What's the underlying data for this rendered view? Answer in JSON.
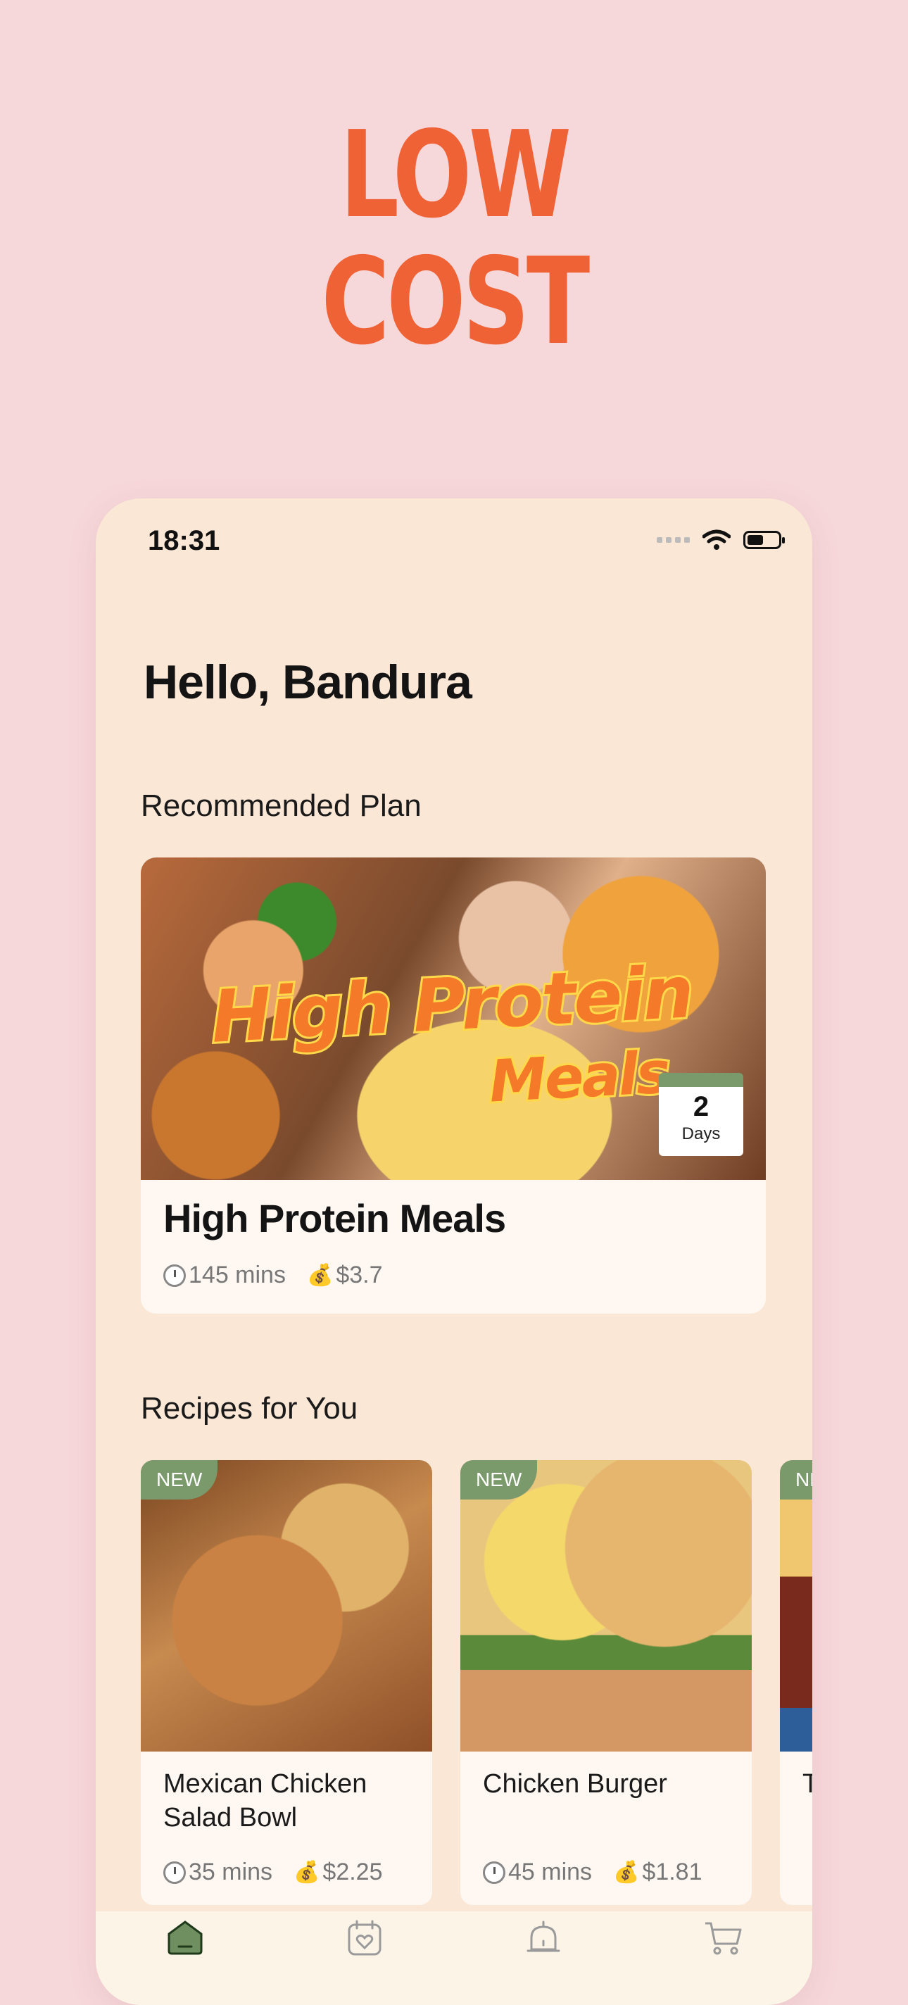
{
  "promo": {
    "line1": "LOW",
    "line2": "COST"
  },
  "status_bar": {
    "time": "18:31"
  },
  "greeting": "Hello, Bandura",
  "recommended": {
    "section_title": "Recommended Plan",
    "plan": {
      "image_text_line1": "High Protein",
      "image_text_line2": "Meals",
      "days_value": "2",
      "days_label": "Days",
      "title": "High Protein Meals",
      "time": "145 mins",
      "price": "$3.7"
    }
  },
  "recipes": {
    "section_title": "Recipes for You",
    "items": [
      {
        "badge": "NEW",
        "title": "Mexican Chicken Salad Bowl",
        "time": "35 mins",
        "price": "$2.25"
      },
      {
        "badge": "NEW",
        "title": "Chicken Burger",
        "time": "45 mins",
        "price": "$1.81"
      },
      {
        "badge": "NEW",
        "title": "T"
      }
    ]
  },
  "tabs": [
    {
      "icon": "home-icon",
      "active": true
    },
    {
      "icon": "calendar-heart-icon",
      "active": false
    },
    {
      "icon": "bell-icon",
      "active": false
    },
    {
      "icon": "cart-icon",
      "active": false
    }
  ],
  "colors": {
    "accent": "#ef6235",
    "background": "#f6d7da",
    "card_bg": "#fbe7d6",
    "badge_green": "#7b9a6c"
  }
}
